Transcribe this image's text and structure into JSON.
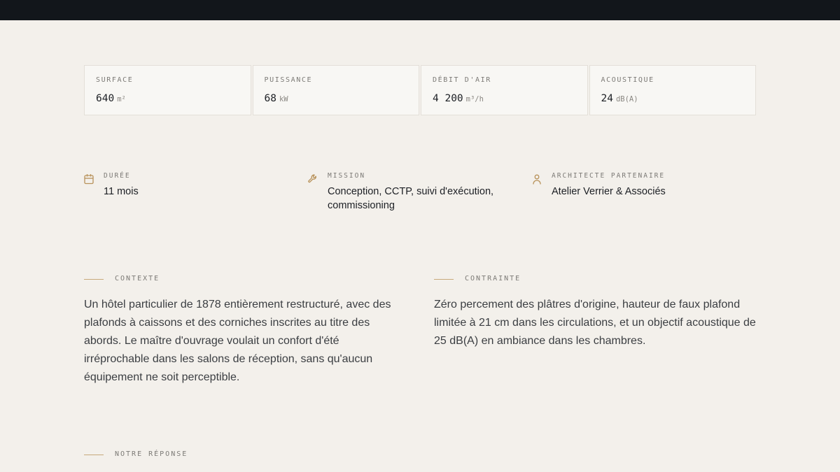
{
  "stats": [
    {
      "label": "SURFACE",
      "value": "640",
      "unit": "m²"
    },
    {
      "label": "PUISSANCE",
      "value": "68",
      "unit": "kW"
    },
    {
      "label": "DÉBIT D'AIR",
      "value": "4 200",
      "unit": "m³/h"
    },
    {
      "label": "ACOUSTIQUE",
      "value": "24",
      "unit": "dB(A)"
    }
  ],
  "meta": [
    {
      "icon": "calendar-icon",
      "label": "DURÉE",
      "value": "11 mois"
    },
    {
      "icon": "wrench-icon",
      "label": "MISSION",
      "value": "Conception, CCTP, suivi d'exécution, commissioning"
    },
    {
      "icon": "user-icon",
      "label": "ARCHITECTE PARTENAIRE",
      "value": "Atelier Verrier & Associés"
    }
  ],
  "sections": {
    "contexte": {
      "label": "CONTEXTE",
      "text": "Un hôtel particulier de 1878 entièrement restructuré, avec des plafonds à caissons et des corniches inscrites au titre des abords. Le maître d'ouvrage voulait un confort d'été irréprochable dans les salons de réception, sans qu'aucun équipement ne soit perceptible."
    },
    "contrainte": {
      "label": "CONTRAINTE",
      "text": "Zéro percement des plâtres d'origine, hauteur de faux plafond limitée à 21 cm dans les circulations, et un objectif acoustique de 25 dB(A) en ambiance dans les chambres."
    },
    "reponse": {
      "label": "NOTRE RÉPONSE"
    }
  },
  "colors": {
    "background": "#f3f0eb",
    "topbar": "#12161b",
    "accent": "#b8925a"
  }
}
